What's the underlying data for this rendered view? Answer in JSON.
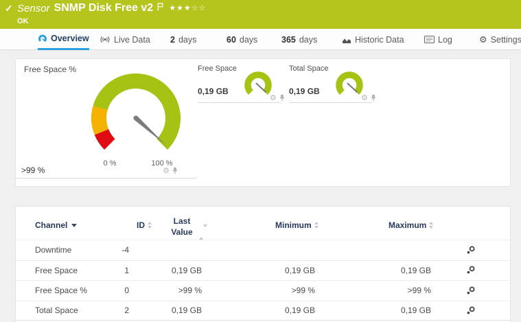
{
  "header": {
    "kind": "Sensor",
    "title": "SNMP Disk Free v2",
    "status": "OK",
    "stars": "★★★☆☆"
  },
  "icons": {
    "check": "✓",
    "gear": "⚙"
  },
  "tabs": {
    "overview": "Overview",
    "live_data": "Live Data",
    "d2_num": "2",
    "d2_unit": "days",
    "d60_num": "60",
    "d60_unit": "days",
    "d365_num": "365",
    "d365_unit": "days",
    "historic": "Historic Data",
    "log": "Log",
    "settings": "Settings"
  },
  "gauges": {
    "primary": {
      "title": "Free Space %",
      "value": ">99 %",
      "min_label": "0 %",
      "max_label": "100 %"
    },
    "mini": [
      {
        "title": "Free Space",
        "value": "0,19 GB"
      },
      {
        "title": "Total Space",
        "value": "0,19 GB"
      }
    ]
  },
  "table": {
    "headers": {
      "channel": "Channel",
      "id": "ID",
      "last_value": "Last Value",
      "minimum": "Minimum",
      "maximum": "Maximum"
    },
    "rows": [
      {
        "channel": "Downtime",
        "id": "-4",
        "last": "",
        "min": "",
        "max": ""
      },
      {
        "channel": "Free Space",
        "id": "1",
        "last": "0,19 GB",
        "min": "0,19 GB",
        "max": "0,19 GB"
      },
      {
        "channel": "Free Space %",
        "id": "0",
        "last": ">99 %",
        "min": ">99 %",
        "max": ">99 %"
      },
      {
        "channel": "Total Space",
        "id": "2",
        "last": "0,19 GB",
        "min": "0,19 GB",
        "max": "0,19 GB"
      }
    ]
  },
  "colors": {
    "header_green": "#b5c51d",
    "gauge_green": "#a6c213",
    "gauge_yellow": "#f3b200",
    "gauge_red": "#e10c12",
    "accent_blue": "#2aa0dc"
  }
}
